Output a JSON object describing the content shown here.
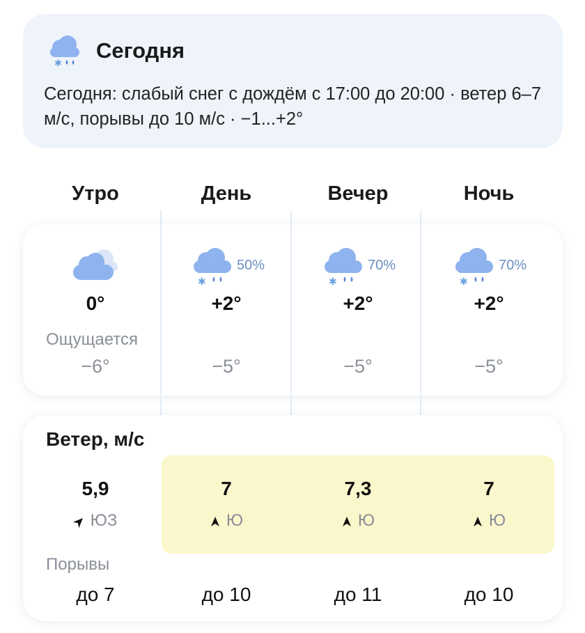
{
  "summary": {
    "icon": "cloud-snow-rain-icon",
    "title": "Сегодня",
    "text": "Сегодня: слабый снег с дождём с 17:00 до 20:00 · ветер 6–7 м/с, порывы до 10 м/с · −1...+2°"
  },
  "periods": [
    {
      "name": "Утро",
      "icon": "partly-cloudy-icon",
      "precip": "",
      "temp": "0°",
      "feels": "−6°",
      "wind_speed": "5,9",
      "wind_dir": "ЮЗ",
      "gust": "до 7",
      "highlight": false
    },
    {
      "name": "День",
      "icon": "cloud-snow-rain-icon",
      "precip": "50%",
      "temp": "+2°",
      "feels": "−5°",
      "wind_speed": "7",
      "wind_dir": "Ю",
      "gust": "до 10",
      "highlight": true
    },
    {
      "name": "Вечер",
      "icon": "cloud-snow-rain-icon",
      "precip": "70%",
      "temp": "+2°",
      "feels": "−5°",
      "wind_speed": "7,3",
      "wind_dir": "Ю",
      "gust": "до 11",
      "highlight": true
    },
    {
      "name": "Ночь",
      "icon": "cloud-snow-rain-icon",
      "precip": "70%",
      "temp": "+2°",
      "feels": "−5°",
      "wind_speed": "7",
      "wind_dir": "Ю",
      "gust": "до 10",
      "highlight": true
    }
  ],
  "labels": {
    "feels_like": "Ощущается",
    "wind_title": "Ветер, м/с",
    "gusts": "Порывы"
  },
  "colors": {
    "summary_bg": "#eef4fa",
    "cloud": "#8fb3ee",
    "precip_text": "#6a8fc2",
    "muted_text": "#8a8f98",
    "wind_highlight": "#fbf7cc"
  }
}
